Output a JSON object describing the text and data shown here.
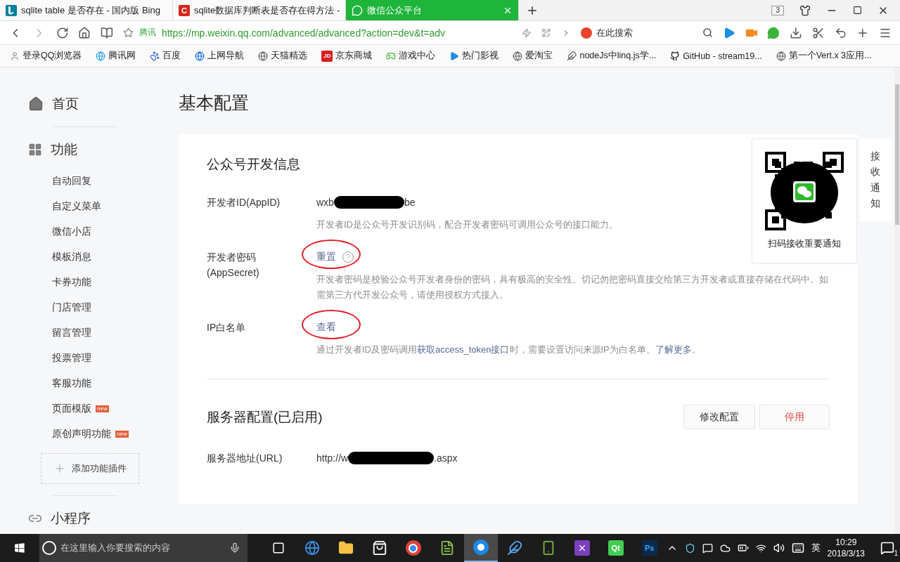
{
  "browser": {
    "tabs": [
      {
        "kind": "bing",
        "title": "sqlite table 是否存在 - 国内版 Bing",
        "selected": false
      },
      {
        "kind": "csdn",
        "icon_letter": "C",
        "title": "sqlite数据库判断表是否存在得方法 -",
        "selected": false
      },
      {
        "kind": "wechat",
        "title": "微信公众平台",
        "selected": true
      }
    ],
    "tab_count": "3",
    "address": {
      "site_label": "腾讯",
      "url": "https://mp.weixin.qq.com/advanced/advanced?action=dev&t=adv"
    },
    "search": {
      "placeholder": "在此搜索"
    },
    "bookmarks": [
      {
        "kind": "user",
        "label": "登录QQ浏览器"
      },
      {
        "kind": "qq",
        "label": "腾讯网"
      },
      {
        "kind": "paw",
        "label": "百度"
      },
      {
        "kind": "ie",
        "label": "上网导航"
      },
      {
        "kind": "globe",
        "label": "天猫精选"
      },
      {
        "kind": "jd",
        "icon_letter": "JD",
        "label": "京东商城"
      },
      {
        "kind": "game",
        "label": "游戏中心"
      },
      {
        "kind": "video",
        "label": "热门影视"
      },
      {
        "kind": "globe",
        "label": "爱淘宝"
      },
      {
        "kind": "feather",
        "label": "nodeJs中linq.js学..."
      },
      {
        "kind": "github",
        "label": "GitHub - stream19..."
      },
      {
        "kind": "globe",
        "label": "第一个Vert.x 3应用..."
      }
    ]
  },
  "sidebar": {
    "sections": [
      {
        "kind": "home",
        "title": "首页"
      },
      {
        "kind": "grid",
        "title": "功能",
        "items": [
          {
            "label": "自动回复"
          },
          {
            "label": "自定义菜单"
          },
          {
            "label": "微信小店"
          },
          {
            "label": "模板消息"
          },
          {
            "label": "卡券功能"
          },
          {
            "label": "门店管理"
          },
          {
            "label": "留言管理"
          },
          {
            "label": "投票管理"
          },
          {
            "label": "客服功能"
          },
          {
            "label": "页面模版",
            "badge": "new"
          },
          {
            "label": "原创声明功能",
            "badge": "new"
          }
        ],
        "add_plugin": "添加功能插件"
      },
      {
        "kind": "link",
        "title": "小程序"
      }
    ]
  },
  "page_title": "基本配置",
  "sections": [
    {
      "title": "公众号开发信息",
      "rows": [
        {
          "label": "开发者ID(AppID)",
          "kind": "redacted",
          "value_start": "wxb",
          "value_end": "be",
          "hint": [
            {
              "kind": "text",
              "text": "开发者ID是公众号开发识别码，配合开发者密码可调用公众号的接口能力。"
            }
          ]
        },
        {
          "label": "开发者密码(AppSecret)",
          "kind": "action",
          "action": "重置",
          "help": true,
          "circled": true,
          "hint": [
            {
              "kind": "text",
              "text": "开发者密码是校验公众号开发者身份的密码，具有极高的安全性。切记勿把密码直接交给第三方开发者或直接存储在代码中。如需第三方代开发公众号，请使用授权方式接入。"
            }
          ]
        },
        {
          "label": "IP白名单",
          "kind": "action",
          "action": "查看",
          "circled": true,
          "hint": [
            {
              "kind": "text",
              "text": "通过开发者ID及密码调用"
            },
            {
              "kind": "link",
              "text": "获取access_token接口"
            },
            {
              "kind": "text",
              "text": "时，需要设置访问来源IP为白名单。"
            },
            {
              "kind": "link",
              "text": "了解更多"
            },
            {
              "kind": "text",
              "text": "。"
            }
          ]
        }
      ]
    },
    {
      "title": "服务器配置",
      "status": "(已启用)",
      "actions": [
        {
          "label": "修改配置",
          "kind": "default"
        },
        {
          "label": "停用",
          "kind": "danger"
        }
      ],
      "rows": [
        {
          "label": "服务器地址(URL)",
          "kind": "redacted",
          "value_start": "http://w",
          "value_end": ".aspx"
        }
      ]
    }
  ],
  "qr_popup": {
    "caption": "扫码接收重要通知"
  },
  "side_tab": {
    "label": "接收通知"
  },
  "taskbar": {
    "search_placeholder": "在这里输入你要搜索的内容",
    "apps": [
      {
        "kind": "taskview",
        "selected": false
      },
      {
        "kind": "edge",
        "selected": false
      },
      {
        "kind": "files",
        "selected": false
      },
      {
        "kind": "store",
        "selected": false
      },
      {
        "kind": "chrome",
        "selected": false
      },
      {
        "kind": "notepad",
        "selected": false
      },
      {
        "kind": "browser",
        "selected": true
      },
      {
        "kind": "feather",
        "selected": false
      },
      {
        "kind": "android",
        "selected": false
      },
      {
        "kind": "vs",
        "selected": false
      },
      {
        "kind": "qt",
        "label": "Qt",
        "selected": false
      },
      {
        "kind": "ps",
        "label": "Ps",
        "selected": false
      }
    ],
    "ime": "英",
    "time": "10:29",
    "date": "2018/3/13",
    "notifications": "1"
  }
}
